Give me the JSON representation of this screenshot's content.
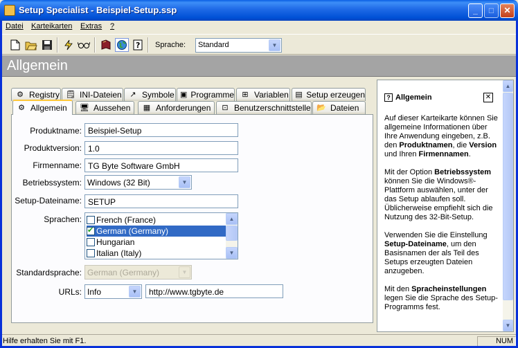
{
  "window": {
    "title": "Setup Specialist - Beispiel-Setup.ssp",
    "minimize_glyph": "_",
    "maximize_glyph": "□",
    "close_glyph": "✕"
  },
  "menu": [
    "Datei",
    "Karteikarten",
    "Extras",
    "?"
  ],
  "toolbar": {
    "language_label": "Sprache:",
    "language_value": "Standard"
  },
  "header": {
    "title": "Allgemein"
  },
  "tabs": {
    "back_row": [
      "Registry",
      "INI-Dateien",
      "Symbole",
      "Programme",
      "Variablen",
      "Setup erzeugen"
    ],
    "front_row": [
      "Allgemein",
      "Aussehen",
      "Anforderungen",
      "Benutzerschnittstelle",
      "Dateien"
    ]
  },
  "form": {
    "product_name_label": "Produktname:",
    "product_name_value": "Beispiel-Setup",
    "product_version_label": "Produktversion:",
    "product_version_value": "1.0",
    "company_label": "Firmenname:",
    "company_value": "TG Byte Software GmbH",
    "os_label": "Betriebssystem:",
    "os_value": "Windows (32 Bit)",
    "setup_file_label": "Setup-Dateiname:",
    "setup_file_value": "SETUP",
    "languages_label": "Sprachen:",
    "languages": [
      {
        "label": "French (France)",
        "checked": false
      },
      {
        "label": "German (Germany)",
        "checked": true
      },
      {
        "label": "Hungarian",
        "checked": false
      },
      {
        "label": "Italian (Italy)",
        "checked": false
      }
    ],
    "default_language_label": "Standardsprache:",
    "default_language_value": "German (Germany)",
    "urls_label": "URLs:",
    "url_type_value": "Info",
    "url_value": "http://www.tgbyte.de"
  },
  "help": {
    "title": "Allgemein",
    "p1_a": "Auf dieser Karteikarte können Sie allgemeine Informationen über Ihre Anwendung eingeben, z.B. den ",
    "p1_b1": "Produktnamen",
    "p1_c": ", die ",
    "p1_b2": "Version",
    "p1_d": " und Ihren ",
    "p1_b3": "Firmennamen",
    "p1_e": ".",
    "p2_a": "Mit der Option ",
    "p2_b": "Betriebssystem",
    "p2_c": " können Sie die Windows®-Plattform auswählen, unter der das Setup ablaufen soll. Üblicherweise empfiehlt sich die Nutzung des 32-Bit-Setup.",
    "p3_a": "Verwenden Sie die Einstellung ",
    "p3_b": "Setup-Dateiname",
    "p3_c": ", um den Basisnamen der als Teil des Setups erzeugten Dateien anzugeben.",
    "p4_a": "Mit den ",
    "p4_b": "Spracheinstellungen",
    "p4_c": " legen Sie die Sprache des Setup-Programms fest."
  },
  "status": {
    "text": "Hilfe erhalten Sie mit F1.",
    "num": "NUM"
  },
  "colors": {
    "titlebar": "#0a5fe3",
    "header_band": "#a4a4a4",
    "selection": "#316ac5"
  }
}
